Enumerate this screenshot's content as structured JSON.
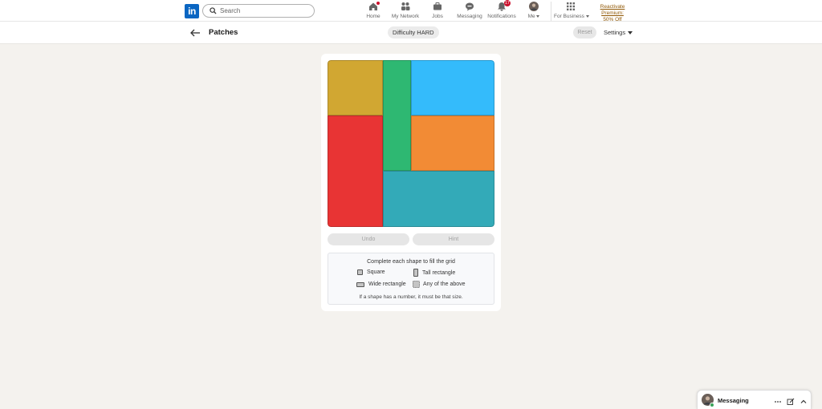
{
  "nav": {
    "logo_text": "in",
    "search_placeholder": "Search",
    "items": [
      {
        "label": "Home",
        "icon": "home-icon"
      },
      {
        "label": "My Network",
        "icon": "network-icon"
      },
      {
        "label": "Jobs",
        "icon": "jobs-icon"
      },
      {
        "label": "Messaging",
        "icon": "messaging-icon"
      },
      {
        "label": "Notifications",
        "icon": "bell-icon",
        "badge": "17"
      },
      {
        "label": "Me",
        "icon": "avatar"
      },
      {
        "label": "For Business",
        "icon": "grid-icon"
      }
    ],
    "premium_line1": "Reactivate Premium:",
    "premium_line2": "50% Off"
  },
  "subheader": {
    "title": "Patches",
    "difficulty": "Difficulty HARD",
    "reset_label": "Reset",
    "settings_label": "Settings"
  },
  "board": {
    "patches": [
      {
        "name": "patch-yellow",
        "color": "#d1a732"
      },
      {
        "name": "patch-green",
        "color": "#2eb872"
      },
      {
        "name": "patch-blue",
        "color": "#34bbfb"
      },
      {
        "name": "patch-red",
        "color": "#e83434"
      },
      {
        "name": "patch-orange",
        "color": "#f28b35"
      },
      {
        "name": "patch-teal",
        "color": "#33aab8"
      }
    ]
  },
  "controls": {
    "undo_label": "Undo",
    "hint_label": "Hint"
  },
  "legend": {
    "heading": "Complete each shape to fill the grid",
    "square": "Square",
    "tall": "Tall rectangle",
    "wide": "Wide rectangle",
    "any": "Any of the above",
    "footer": "If a shape has a number, it must be that size."
  },
  "messaging": {
    "label": "Messaging"
  }
}
